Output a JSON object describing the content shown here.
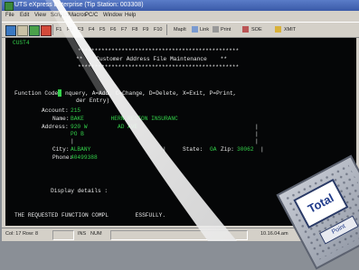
{
  "window": {
    "title": "UTS eXpress Enterprise (Tip Station: 003308)"
  },
  "menu": [
    "File",
    "Edit",
    "View",
    "Scripts/Macros",
    "PC/C",
    "Window",
    "Help"
  ],
  "toolbar": {
    "fkeys": [
      "F1",
      "F2",
      "F3",
      "F4",
      "F5",
      "F6",
      "F7",
      "F8",
      "F9",
      "F10"
    ],
    "buttons": [
      "MapIt",
      "Link",
      "Print",
      "SOE",
      "XMIT"
    ]
  },
  "terminal": {
    "tag": "CUST4",
    "stars_top": "************************************************",
    "title_line": "**    Customer Address File Maintenance    **",
    "stars_bottom": "************************************************",
    "fc_label": "Function Code:",
    "fc_text": "nquery, A=Add, C=Change, D=Delete, X=Exit, P=Print,",
    "fc_text2": "der Entry)",
    "account_label": "Account:",
    "account_value": "215",
    "name_label": "Name:",
    "name_value": "BAKE        HERN REGION INSURANC",
    "address_label": "Address:",
    "address_line1": "920 W         AD AVE",
    "address_line2": "PO B",
    "city_label": "City:",
    "city_value": "ALBANY",
    "state_label": "State:",
    "state_value": "GA",
    "zip_label": "Zip:",
    "zip_value": "30062",
    "phone_label": "Phone:",
    "phone_value": "40499388",
    "display_label": "Display details :",
    "message": "THE REQUESTED FUNCTION COMPL        ESSFULLY."
  },
  "status": {
    "cursor": "Col: 17 Row: 8",
    "ins": "INS",
    "num": "NUM",
    "ip": "10.16.04.am"
  },
  "sticker": {
    "label": "Total",
    "sub": "Point"
  }
}
